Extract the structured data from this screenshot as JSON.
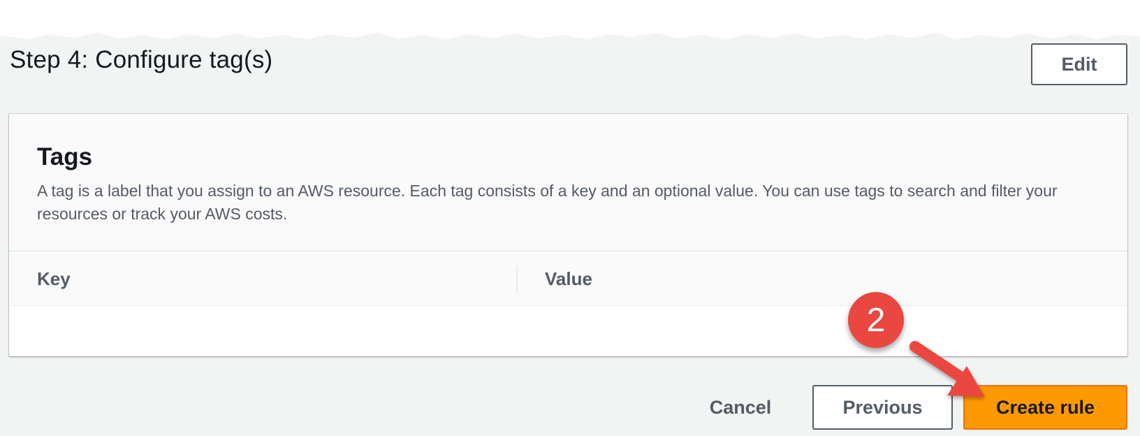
{
  "header": {
    "step_title": "Step 4: Configure tag(s)",
    "edit_label": "Edit"
  },
  "tags_panel": {
    "title": "Tags",
    "description": "A tag is a label that you assign to an AWS resource. Each tag consists of a key and an optional value. You can use tags to search and filter your resources or track your AWS costs.",
    "columns": [
      "Key",
      "Value"
    ],
    "rows": []
  },
  "footer": {
    "cancel_label": "Cancel",
    "previous_label": "Previous",
    "create_label": "Create rule"
  },
  "annotation": {
    "badge_number": "2",
    "badge_color": "#e9473f",
    "arrow_color": "#e9473f"
  },
  "colors": {
    "primary_button": "#ff9900",
    "page_background": "#f2f3f3",
    "text_secondary": "#545b64"
  }
}
